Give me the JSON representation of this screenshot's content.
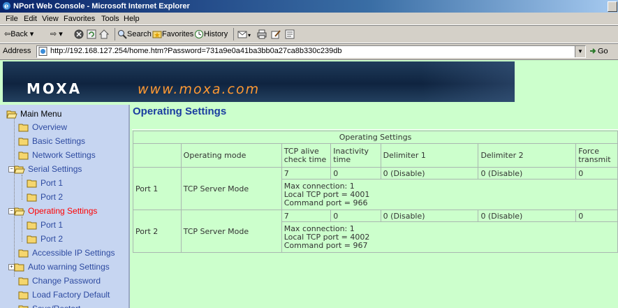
{
  "window": {
    "title": "NPort Web Console - Microsoft Internet Explorer"
  },
  "menu": [
    "File",
    "Edit",
    "View",
    "Favorites",
    "Tools",
    "Help"
  ],
  "toolbar": {
    "back": "Back",
    "search": "Search",
    "favorites": "Favorites",
    "history": "History"
  },
  "address": {
    "label": "Address",
    "url": "http://192.168.127.254/home.htm?Password=731a9e0a41ba3bb0a27ca8b330c239db",
    "go": "Go"
  },
  "banner": {
    "logo": "MOXA",
    "site": "www.moxa.com"
  },
  "sidebar": {
    "main": "Main Menu",
    "items": [
      {
        "label": "Overview"
      },
      {
        "label": "Basic Settings"
      },
      {
        "label": "Network Settings"
      },
      {
        "label": "Serial Settings"
      },
      {
        "label": "Port 1"
      },
      {
        "label": "Port 2"
      },
      {
        "label": "Operating Settings"
      },
      {
        "label": "Port 1"
      },
      {
        "label": "Port 2"
      },
      {
        "label": "Accessible IP Settings"
      },
      {
        "label": "Auto warning Settings"
      },
      {
        "label": "Change Password"
      },
      {
        "label": "Load Factory Default"
      },
      {
        "label": "Save/Restart"
      }
    ]
  },
  "content": {
    "title": "Operating Settings",
    "table": {
      "caption": "Operating Settings",
      "headers": [
        "Operating mode",
        "TCP alive check time",
        "Inactivity time",
        "Delimiter 1",
        "Delimiter 2",
        "Force transmit"
      ],
      "rows": [
        {
          "port": "Port 1",
          "mode": "TCP Server Mode",
          "alive": "7",
          "inactivity": "0",
          "delim1": "0 (Disable)",
          "delim2": "0 (Disable)",
          "force": "0",
          "max_conn": "Max connection: 1",
          "local_port": "Local TCP port = 4001",
          "cmd_port": "Command port = 966"
        },
        {
          "port": "Port 2",
          "mode": "TCP Server Mode",
          "alive": "7",
          "inactivity": "0",
          "delim1": "0 (Disable)",
          "delim2": "0 (Disable)",
          "force": "0",
          "max_conn": "Max connection: 1",
          "local_port": "Local TCP port = 4002",
          "cmd_port": "Command port = 967"
        }
      ]
    }
  },
  "colors": {
    "background": "#ccffcc",
    "sidebar": "#c6d5f1",
    "link": "#2d4aa0",
    "active": "#ff0000",
    "title": "#1a3ca0",
    "banner_text": "#ff9933"
  }
}
